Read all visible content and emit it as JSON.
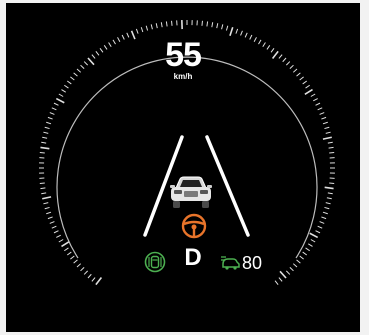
{
  "speed": {
    "value": "55",
    "unit": "km/h"
  },
  "gear": {
    "label": "D"
  },
  "cruise": {
    "set_speed": "80"
  },
  "icons": {
    "lane_keep": "lane-keep-assist-icon",
    "steering": "steering-wheel-icon",
    "cruise": "adaptive-cruise-icon",
    "vehicle": "lead-vehicle-icon"
  },
  "colors": {
    "background": "#000000",
    "lane_lines": "#ffffff",
    "steering_active": "#e8742a",
    "assist_active": "#4caf50"
  }
}
